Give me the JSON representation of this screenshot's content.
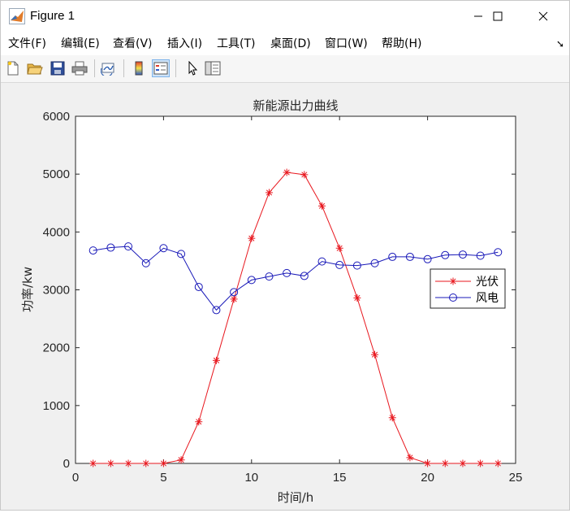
{
  "window": {
    "title": "Figure 1",
    "controls": {
      "minimize": "─",
      "maximize": "☐",
      "close": "✕"
    }
  },
  "menu": [
    "文件(F)",
    "编辑(E)",
    "查看(V)",
    "插入(I)",
    "工具(T)",
    "桌面(D)",
    "窗口(W)",
    "帮助(H)"
  ],
  "toolbar": [
    "new-figure-icon",
    "open-icon",
    "save-icon",
    "print-icon",
    "link-plot-icon",
    "insert-colorbar-icon",
    "insert-legend-icon",
    "edit-plot-icon",
    "property-inspector-icon"
  ],
  "chart_data": {
    "type": "line",
    "title": "新能源出力曲线",
    "xlabel": "时间/h",
    "ylabel": "功率/kw",
    "xlim": [
      0,
      25
    ],
    "ylim": [
      0,
      6000
    ],
    "xticks": [
      0,
      5,
      10,
      15,
      20,
      25
    ],
    "yticks": [
      0,
      1000,
      2000,
      3000,
      4000,
      5000,
      6000
    ],
    "grid": false,
    "legend_position": "right",
    "x": [
      1,
      2,
      3,
      4,
      5,
      6,
      7,
      8,
      9,
      10,
      11,
      12,
      13,
      14,
      15,
      16,
      17,
      18,
      19,
      20,
      21,
      22,
      23,
      24
    ],
    "series": [
      {
        "name": "光伏",
        "color": "#e8171e",
        "marker": "asterisk",
        "values": [
          0,
          0,
          0,
          0,
          0,
          60,
          720,
          1780,
          2840,
          3890,
          4680,
          5030,
          4990,
          4450,
          3720,
          2860,
          1880,
          790,
          100,
          0,
          0,
          0,
          0,
          0
        ]
      },
      {
        "name": "风电",
        "color": "#1818b8",
        "marker": "circle",
        "values": [
          3680,
          3730,
          3750,
          3460,
          3720,
          3620,
          3050,
          2650,
          2960,
          3170,
          3230,
          3290,
          3240,
          3490,
          3430,
          3420,
          3460,
          3570,
          3570,
          3530,
          3600,
          3610,
          3590,
          3650
        ]
      }
    ]
  }
}
